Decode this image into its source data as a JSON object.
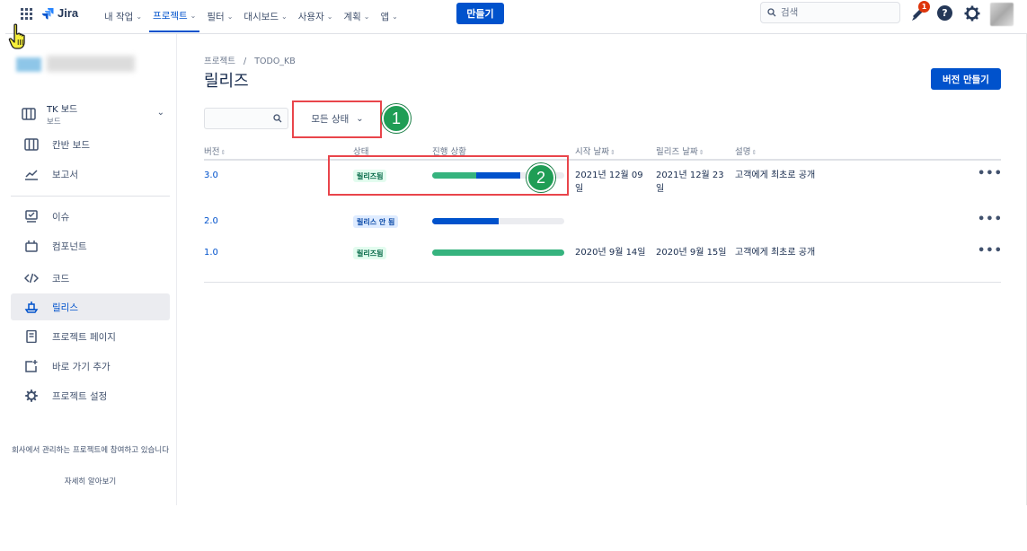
{
  "topnav": {
    "logo": "Jira",
    "items": [
      {
        "label": "내 작업"
      },
      {
        "label": "프로젝트"
      },
      {
        "label": "필터"
      },
      {
        "label": "대시보드"
      },
      {
        "label": "사용자"
      },
      {
        "label": "계획"
      },
      {
        "label": "앱"
      }
    ],
    "active_item": "프로젝트",
    "create_label": "만들기",
    "search_placeholder": "검색",
    "notification_count": "1",
    "help_glyph": "?"
  },
  "sidebar": {
    "board": {
      "title": "TK 보드",
      "subtitle": "보드"
    },
    "items_top": [
      {
        "label": "칸반 보드",
        "icon": "kanban-icon"
      },
      {
        "label": "보고서",
        "icon": "report-icon"
      }
    ],
    "items": [
      {
        "label": "이슈",
        "icon": "issue-icon"
      },
      {
        "label": "컴포넌트",
        "icon": "component-icon"
      },
      {
        "label": "코드",
        "icon": "code-icon"
      },
      {
        "label": "릴리스",
        "icon": "release-icon",
        "active": true
      },
      {
        "label": "프로젝트 페이지",
        "icon": "page-icon"
      },
      {
        "label": "바로 가기 추가",
        "icon": "add-shortcut-icon"
      },
      {
        "label": "프로젝트 설정",
        "icon": "settings-icon"
      }
    ],
    "footer_text": "회사에서 관리하는 프로젝트에 참여하고 있습니다",
    "footer_link": "자세히 알아보기"
  },
  "main": {
    "breadcrumb": [
      "프로젝트",
      "/",
      "TODO_KB"
    ],
    "title": "릴리즈",
    "new_version_label": "버전 만들기",
    "status_filter": "모든 상태",
    "columns": [
      "버전",
      "상태",
      "진행 상황",
      "시작 날짜",
      "릴리즈 날짜",
      "설명"
    ],
    "rows": [
      {
        "version": "3.0",
        "status": "릴리즈됨",
        "status_type": "released",
        "progress_done": 0.33,
        "progress_inprogress": 0.34,
        "start": "2021년 12월 09일",
        "release": "2021년 12월 23일",
        "description": "고객에게 최초로 공개"
      },
      {
        "version": "2.0",
        "status": "릴리스 안 됨",
        "status_type": "unreleased",
        "progress_done": 0.0,
        "progress_inprogress": 0.5,
        "start": "",
        "release": "",
        "description": ""
      },
      {
        "version": "1.0",
        "status": "릴리즈됨",
        "status_type": "released",
        "progress_done": 1.0,
        "progress_inprogress": 0.0,
        "start": "2020년 9월 14일",
        "release": "2020년 9월 15일",
        "description": "고객에게 최초로 공개"
      }
    ],
    "more_glyph": "•••"
  },
  "annotations": {
    "step1": "1",
    "step2": "2"
  },
  "colors": {
    "accent": "#0052cc",
    "done": "#36b37e",
    "highlight": "#e9454b",
    "step": "#1f9d55"
  }
}
